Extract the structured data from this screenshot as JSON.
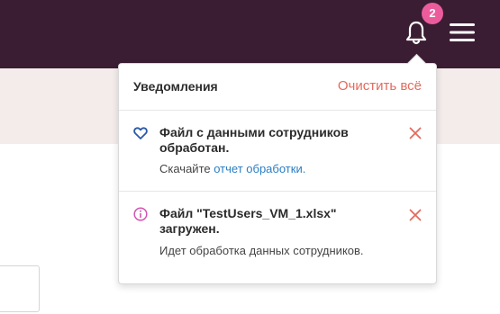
{
  "header": {
    "notification_count": "2",
    "icons": {
      "bell": "bell-icon",
      "menu": "hamburger-menu-icon"
    }
  },
  "notifications_panel": {
    "title": "Уведомления",
    "clear_all_label": "Очистить всё",
    "items": [
      {
        "icon": "heart-icon",
        "title": "Файл с данными сотрудников обработан.",
        "body_prefix": "Скачайте",
        "body_link": "отчет обработки."
      },
      {
        "icon": "info-icon",
        "title": "Файл \"TestUsers_VM_1.xlsx\" загружен.",
        "body": "Идет обработка данных сотрудников."
      }
    ]
  },
  "colors": {
    "topbar": "#3a1d33",
    "badge": "#ec5c9c",
    "accent_red": "#e56a5c",
    "link": "#2a7ec3",
    "info_icon": "#d455b2",
    "heart_icon": "#2a5aa8"
  }
}
